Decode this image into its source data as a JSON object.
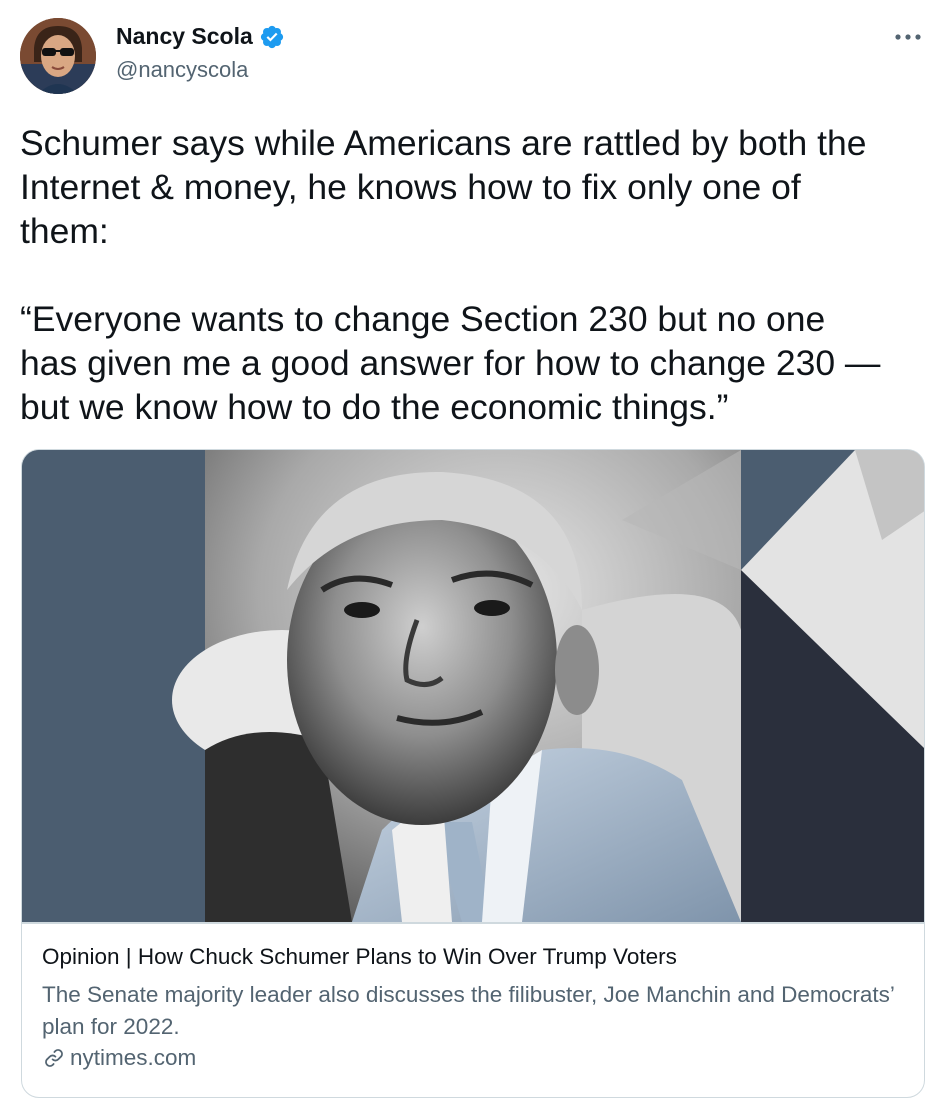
{
  "author": {
    "display_name": "Nancy Scola",
    "handle": "@nancyscola",
    "verified": true
  },
  "tweet": {
    "text": "Schumer says while Americans are rattled by both the\nInternet & money, he knows how to fix only one of\nthem:\n\n“Everyone wants to change Section 230 but no one\nhas given me a good answer for how to change 230 —\nbut we know how to do the economic things.”"
  },
  "card": {
    "title": "Opinion | How Chuck Schumer Plans to Win Over Trump Voters",
    "description": "The Senate majority leader also discusses the filibuster, Joe Manchin and Democrats’ plan for 2022.",
    "domain": "nytimes.com"
  },
  "icons": {
    "verified": "verified-badge-icon",
    "more": "more-options-icon",
    "link": "link-icon"
  },
  "colors": {
    "verified_blue": "#1d9bf0",
    "secondary_text": "#536471",
    "card_border": "#cfd9de",
    "slate_panel": "#4b5d70",
    "dark_panel": "#2a2f3c"
  }
}
